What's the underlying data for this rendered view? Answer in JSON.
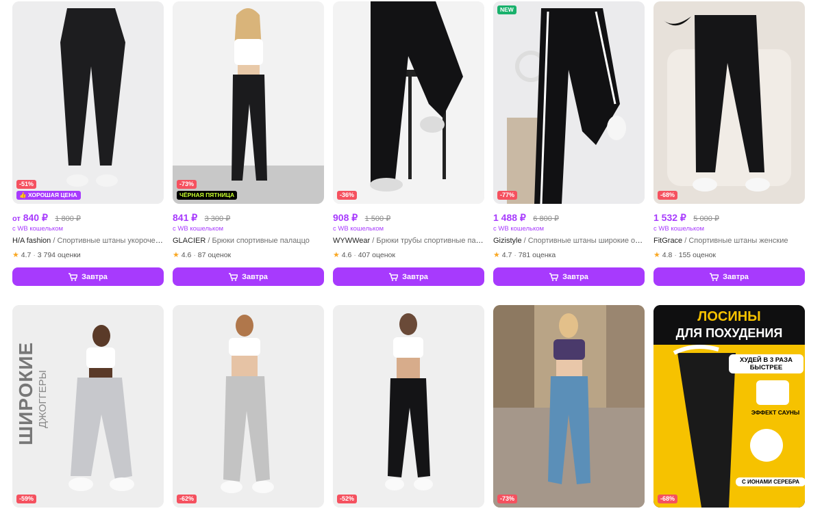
{
  "colors": {
    "accent": "#a73afd",
    "discount": "#f5515f",
    "new_badge": "#19b16c",
    "star": "#f9a825"
  },
  "products_row1": [
    {
      "discount": "-51%",
      "badge": "ХОРОШАЯ ЦЕНА",
      "badge_icon": "thumbs-up-icon",
      "price_prefix": "от",
      "price": "840 ₽",
      "old_price": "1 800 ₽",
      "wallet": "с WB кошельком",
      "brand": "H/A fashion",
      "sep": " / ",
      "name": "Спортивные штаны укороченные",
      "rating": "4.7",
      "reviews": "3 794 оценки",
      "button": "Завтра"
    },
    {
      "discount": "-73%",
      "badge": "ЧЁРНАЯ ПЯТНИЦА",
      "price": "841 ₽",
      "old_price": "3 300 ₽",
      "wallet": "с WB кошельком",
      "brand": "GLACIER",
      "sep": " / ",
      "name": "Брюки спортивные палаццо",
      "rating": "4.6",
      "reviews": "87 оценок",
      "button": "Завтра"
    },
    {
      "discount": "-36%",
      "price": "908 ₽",
      "old_price": "1 500 ₽",
      "wallet": "с WB кошельком",
      "brand": "WYWWear",
      "sep": " / ",
      "name": "Брюки трубы спортивные палаццо",
      "rating": "4.6",
      "reviews": "407 оценок",
      "button": "Завтра"
    },
    {
      "discount": "-77%",
      "new": "NEW",
      "price": "1 488 ₽",
      "old_price": "6 800 ₽",
      "wallet": "с WB кошельком",
      "brand": "Gizistyle",
      "sep": " / ",
      "name": "Спортивные штаны широкие оверсайз",
      "rating": "4.7",
      "reviews": "781 оценка",
      "button": "Завтра"
    },
    {
      "discount": "-68%",
      "price": "1 532 ₽",
      "old_price": "5 000 ₽",
      "wallet": "с WB кошельком",
      "brand": "FitGrace",
      "sep": " / ",
      "name": "Спортивные штаны женские",
      "rating": "4.8",
      "reviews": "155 оценок",
      "button": "Завтра"
    }
  ],
  "products_row2": [
    {
      "discount": "-59%",
      "overlay_big": "ШИРОКИЕ",
      "overlay_small": "ДЖОГГЕРЫ"
    },
    {
      "discount": "-62%"
    },
    {
      "discount": "-52%"
    },
    {
      "discount": "-73%"
    },
    {
      "discount": "-68%",
      "ad_title_1": "ЛОСИНЫ",
      "ad_title_2": "ДЛЯ ПОХУДЕНИЯ",
      "ad_claim": "ХУДЕЙ В 3 РАЗА БЫСТРЕЕ",
      "ad_effect": "ЭФФЕКТ САУНЫ",
      "ad_silver": "С ИОНАМИ СЕРЕБРА"
    }
  ]
}
